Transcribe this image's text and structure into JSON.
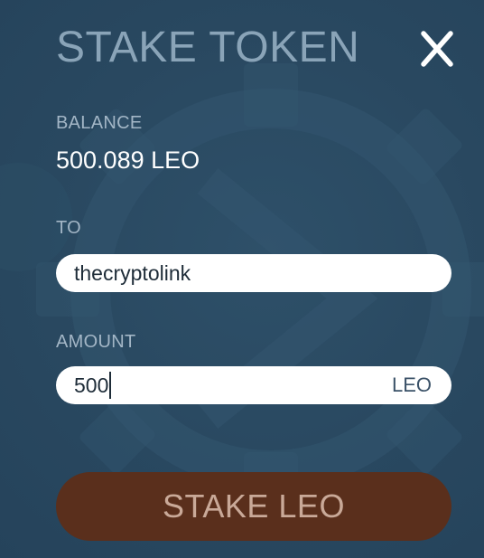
{
  "dialog": {
    "title": "STAKE TOKEN",
    "close_icon": "close-icon"
  },
  "balance": {
    "label": "BALANCE",
    "value": "500.089 LEO"
  },
  "to": {
    "label": "TO",
    "value": "thecryptolink"
  },
  "amount": {
    "label": "AMOUNT",
    "value": "500",
    "unit": "LEO"
  },
  "submit": {
    "label": "STAKE LEO"
  },
  "colors": {
    "background": "#2c4a63",
    "title": "#8aa4b8",
    "label": "#a3b6c6",
    "button": "#5a2f1c",
    "button_text": "#c9a998"
  }
}
